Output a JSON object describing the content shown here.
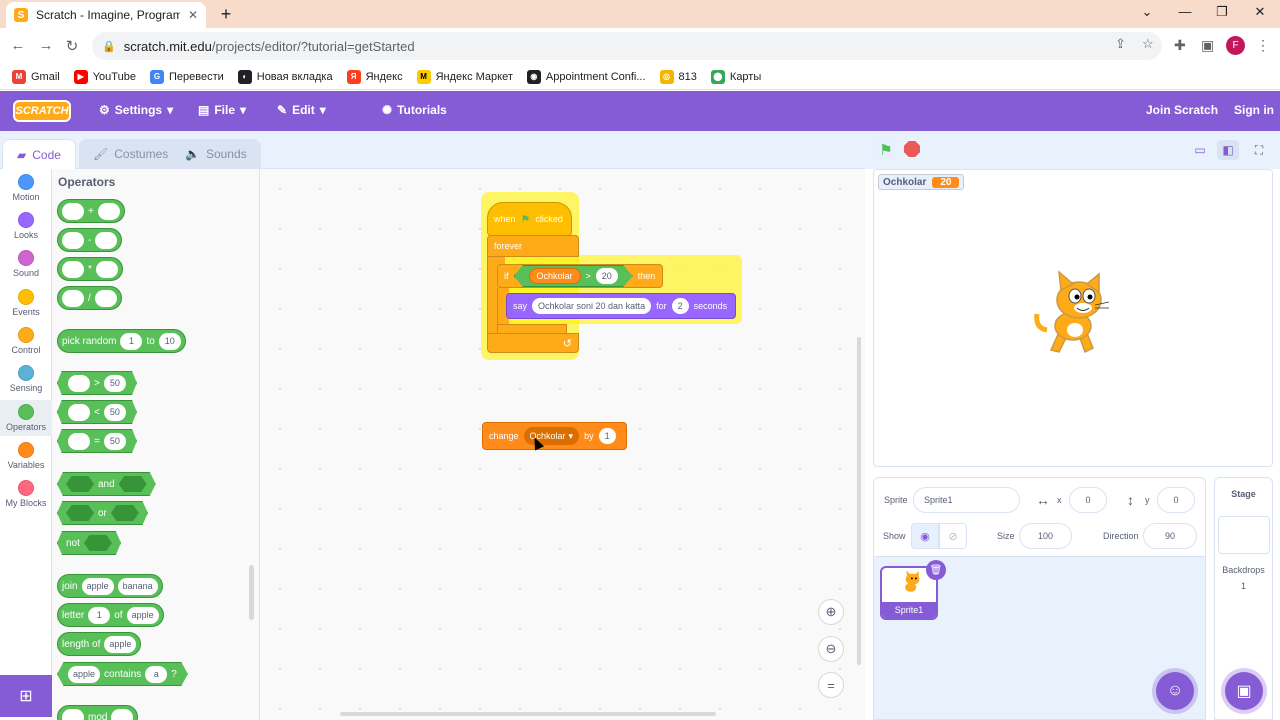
{
  "browser": {
    "tab_title": "Scratch - Imagine, Program, Sha",
    "new_tab": "+",
    "url_host": "scratch.mit.edu",
    "url_path": "/projects/editor/?tutorial=getStarted",
    "profile_initial": "F",
    "bookmarks": [
      {
        "label": "Gmail",
        "color": "#ea4335",
        "glyph": "M"
      },
      {
        "label": "YouTube",
        "color": "#ff0000",
        "glyph": "▶"
      },
      {
        "label": "Перевести",
        "color": "#4285f4",
        "glyph": "G"
      },
      {
        "label": "Новая вкладка",
        "color": "#202124",
        "glyph": "◐"
      },
      {
        "label": "Яндекс",
        "color": "#fc3f1d",
        "glyph": "Я"
      },
      {
        "label": "Яндекс Маркет",
        "color": "#ffcc00",
        "glyph": "M"
      },
      {
        "label": "Appointment Confi...",
        "color": "#202124",
        "glyph": "◉"
      },
      {
        "label": "813",
        "color": "#f4b400",
        "glyph": "◎"
      },
      {
        "label": "Карты",
        "color": "#34a853",
        "glyph": "⬤"
      }
    ]
  },
  "menubar": {
    "logo": "SCRATCH",
    "settings": "Settings",
    "file": "File",
    "edit": "Edit",
    "tutorials": "Tutorials",
    "join": "Join Scratch",
    "signin": "Sign in"
  },
  "editor_tabs": {
    "code": "Code",
    "costumes": "Costumes",
    "sounds": "Sounds"
  },
  "categories": [
    {
      "label": "Motion",
      "color": "#4c97ff"
    },
    {
      "label": "Looks",
      "color": "#9966ff"
    },
    {
      "label": "Sound",
      "color": "#cf63cf"
    },
    {
      "label": "Events",
      "color": "#ffbf00"
    },
    {
      "label": "Control",
      "color": "#ffab19"
    },
    {
      "label": "Sensing",
      "color": "#5cb1d6"
    },
    {
      "label": "Operators",
      "color": "#59c059"
    },
    {
      "label": "Variables",
      "color": "#ff8c1a"
    },
    {
      "label": "My Blocks",
      "color": "#ff6680"
    }
  ],
  "palette": {
    "title": "Operators",
    "add": "+",
    "sub": "-",
    "mul": "*",
    "div": "/",
    "pick_random": "pick random",
    "pick_from": "1",
    "to": "to",
    "pick_to": "10",
    "gt": ">",
    "lt": "<",
    "eq": "=",
    "fifty": "50",
    "and": "and",
    "or": "or",
    "not": "not",
    "join": "join",
    "apple": "apple",
    "banana": "banana",
    "letter": "letter",
    "one": "1",
    "of": "of",
    "length_of": "length of",
    "contains": "contains",
    "a": "a",
    "q": "?",
    "mod": "mod"
  },
  "script": {
    "when": "when",
    "clicked": "clicked",
    "forever": "forever",
    "if": "if",
    "var": "Ochkolar",
    "gt": ">",
    "num": "20",
    "then": "then",
    "say": "say",
    "message": "Ochkolar soni 20 dan katta",
    "for": "for",
    "secs": "2",
    "seconds": "seconds",
    "loop_arrow": "↺"
  },
  "change_block": {
    "change": "change",
    "var": "Ochkolar",
    "by": "by",
    "value": "1"
  },
  "zoom": {
    "in": "⊕",
    "out": "⊖",
    "reset": "="
  },
  "stage": {
    "monitor_name": "Ochkolar",
    "monitor_value": "20"
  },
  "sprite_info": {
    "sprite_label": "Sprite",
    "sprite_name": "Sprite1",
    "x_label": "x",
    "x": "0",
    "y_label": "y",
    "y": "0",
    "show_label": "Show",
    "size_label": "Size",
    "size": "100",
    "direction_label": "Direction",
    "direction": "90"
  },
  "sprite_list": {
    "sprite1": "Sprite1"
  },
  "stage_panel": {
    "title": "Stage",
    "backdrops_label": "Backdrops",
    "backdrops_count": "1"
  }
}
